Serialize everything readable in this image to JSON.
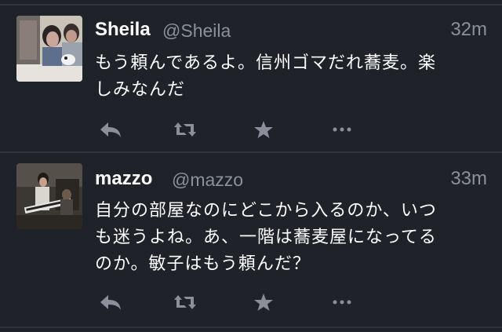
{
  "tweets": [
    {
      "name": "Sheila",
      "handle": "@Sheila",
      "time": "32m",
      "text_lines": [
        "もう頼んであるよ。信州ゴマだれ蕎麦。楽",
        "しみなんだ"
      ]
    },
    {
      "name": "mazzo",
      "handle": "@mazzo",
      "time": "33m",
      "text_lines": [
        "自分の部屋なのにどこから入るのか、いつ",
        "も迷うよね。あ、一階は蕎麦屋になってる",
        "のか。敏子はもう頼んだ？"
      ]
    }
  ],
  "actions": [
    "reply-icon",
    "retweet-icon",
    "favorite-icon",
    "more-icon"
  ],
  "colors": {
    "background": "#1f2229",
    "divider": "#2f333b",
    "muted": "#8b919b",
    "text": "#ffffff"
  }
}
